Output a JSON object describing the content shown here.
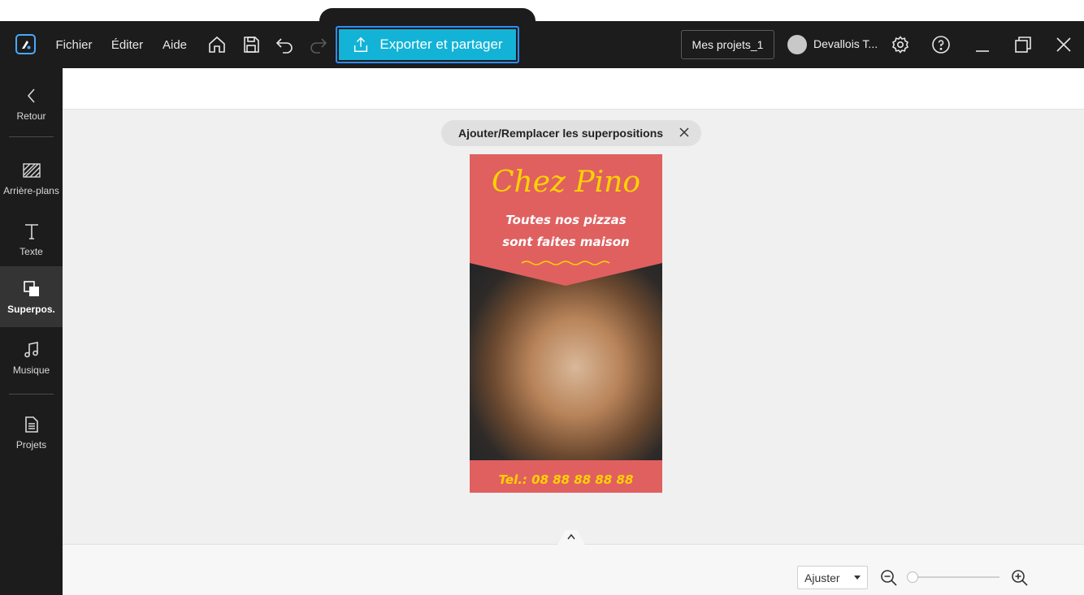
{
  "menu": {
    "file": "Fichier",
    "edit": "Éditer",
    "help": "Aide"
  },
  "toolbar": {
    "export_label": "Exporter et partager"
  },
  "project": {
    "name": "Mes projets_1"
  },
  "user": {
    "name": "Devallois T..."
  },
  "colors": {
    "accent": "#12b3d6",
    "titlebar": "#1c1c1c",
    "poster_red": "#e06060",
    "poster_yellow": "#ffd200"
  },
  "sidebar": {
    "items": [
      {
        "label": "Retour",
        "icon": "chevron-left-icon"
      },
      {
        "label": "Arrière-plans",
        "icon": "background-pattern-icon"
      },
      {
        "label": "Texte",
        "icon": "text-icon"
      },
      {
        "label": "Superpos.",
        "icon": "overlay-icon",
        "active": true
      },
      {
        "label": "Musique",
        "icon": "music-note-icon"
      },
      {
        "label": "Projets",
        "icon": "document-icon"
      }
    ]
  },
  "overlay_chip": {
    "label": "Ajouter/Remplacer les superpositions"
  },
  "poster": {
    "title": "Chez Pino",
    "subtitle_line1": "Toutes nos pizzas",
    "subtitle_line2": "sont faites maison",
    "phone": "Tel.: 08 88 88 88 88"
  },
  "zoom": {
    "mode": "Ajuster",
    "level": 0
  }
}
